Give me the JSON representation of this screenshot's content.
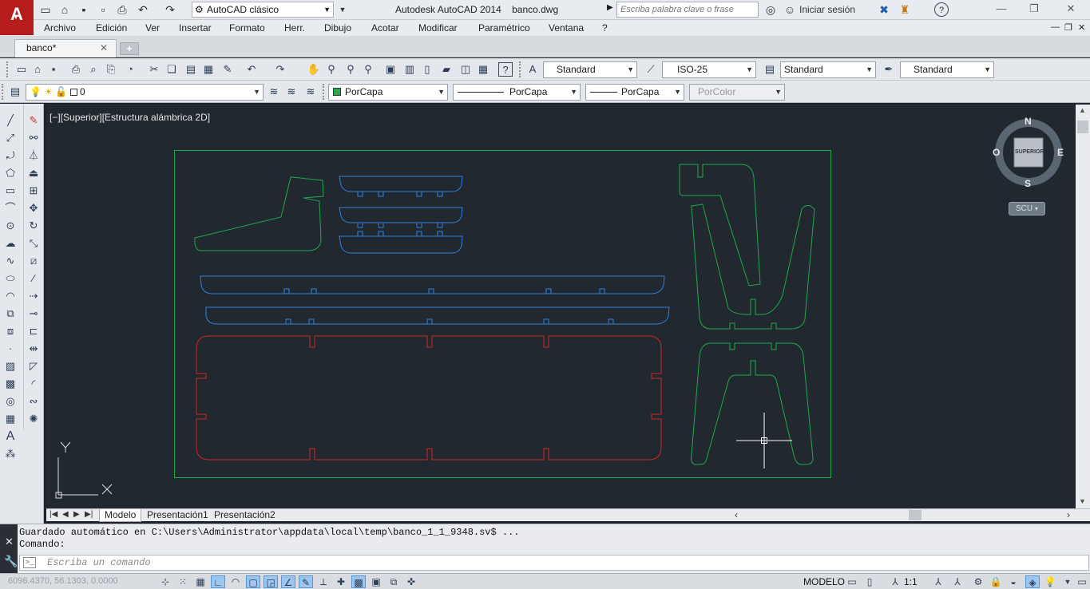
{
  "title_bar": {
    "app_logo": "A",
    "workspace": "AutoCAD clásico",
    "window_title": "Autodesk AutoCAD 2014    banco.dwg",
    "search_placeholder": "Escriba palabra clave o frase",
    "signin": "Iniciar sesión",
    "help": "?"
  },
  "menu": [
    "Archivo",
    "Edición",
    "Ver",
    "Insertar",
    "Formato",
    "Herr.",
    "Dibujo",
    "Acotar",
    "Modificar",
    "Paramétrico",
    "Ventana",
    "?"
  ],
  "doc_tab": {
    "label": "banco*",
    "close": "✕"
  },
  "styles_toolbar": {
    "text_style": "Standard",
    "dim_style": "ISO-25",
    "table_style": "Standard",
    "mleader_style": "Standard"
  },
  "layers_toolbar": {
    "current_layer": "0"
  },
  "properties_toolbar": {
    "color": "PorCapa",
    "linetype": "PorCapa",
    "lineweight": "PorCapa",
    "plotstyle": "PorColor"
  },
  "viewport": {
    "label": "[−][Superior][Estructura alámbrica 2D]"
  },
  "viewcube": {
    "north": "N",
    "south": "S",
    "east": "E",
    "west": "O",
    "face": "SUPERIOR",
    "ucs": "SCU"
  },
  "layout_tabs": [
    "Modelo",
    "Presentación1",
    "Presentación2"
  ],
  "command_line": {
    "history": [
      "Guardado automático en C:\\Users\\Administrator\\appdata\\local\\temp\\banco_1_1_9348.sv$ ...",
      "Comando:"
    ],
    "placeholder": "Escriba un comando"
  },
  "status_bar": {
    "coords": "6096.4370, 56.1303, 0.0000",
    "model": "MODELO",
    "annotation_scale": "1:1"
  },
  "colors": {
    "canvas": "#212830",
    "green_lines": "#1fa84a",
    "blue_lines": "#2f7fe0",
    "red_lines": "#d32626",
    "logo_red": "#b61c1c"
  }
}
